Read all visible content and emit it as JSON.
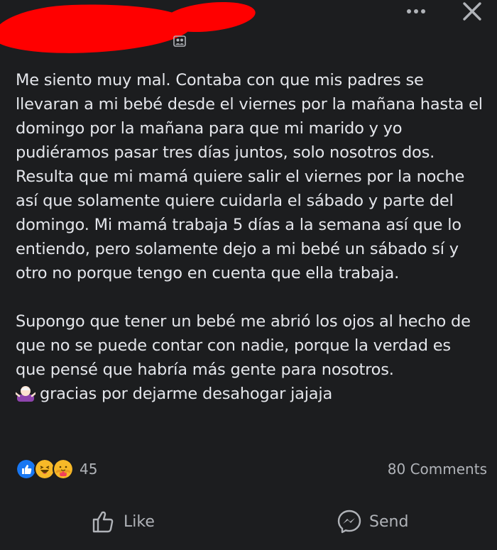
{
  "header": {
    "more_icon": "more-horizontal-icon",
    "close_icon": "close-icon",
    "privacy_icon": "friends-icon"
  },
  "post": {
    "paragraphs": [
      "Me siento muy mal. Contaba con que mis padres se llevaran a mi bebé desde el viernes por la mañana hasta el domingo por la mañana para que mi marido y yo pudiéramos pasar tres días juntos, solo nosotros dos. Resulta que mi mamá quiere salir el viernes por la noche así que solamente quiere cuidarla el sábado y parte del domingo. Mi mamá trabaja 5 días a la semana así que lo entiendo, pero solamente dejo a mi bebé un sábado sí y otro no porque tengo en cuenta que ella trabaja.",
      "Supongo que tener un bebé me abrió los ojos al hecho de que no se puede contar con nadie, porque la verdad es que pensé que habría más gente para nosotros."
    ],
    "closing_line": "gracias por dejarme desahogar jajaja",
    "closing_emoji": "person-shrugging-emoji"
  },
  "reactions": {
    "icons": [
      "like-reaction-icon",
      "haha-reaction-icon",
      "care-reaction-icon"
    ],
    "count": "45",
    "comments": "80 Comments"
  },
  "actions": {
    "like_label": "Like",
    "send_label": "Send",
    "like_icon": "thumbs-up-icon",
    "send_icon": "messenger-icon"
  },
  "colors": {
    "background": "#1c1d1f",
    "text": "#e4e6eb",
    "secondary_text": "#b0b3b8",
    "like_blue": "#1877f2",
    "haha_yellow": "#f7b928",
    "redaction_red": "#ff0000"
  }
}
